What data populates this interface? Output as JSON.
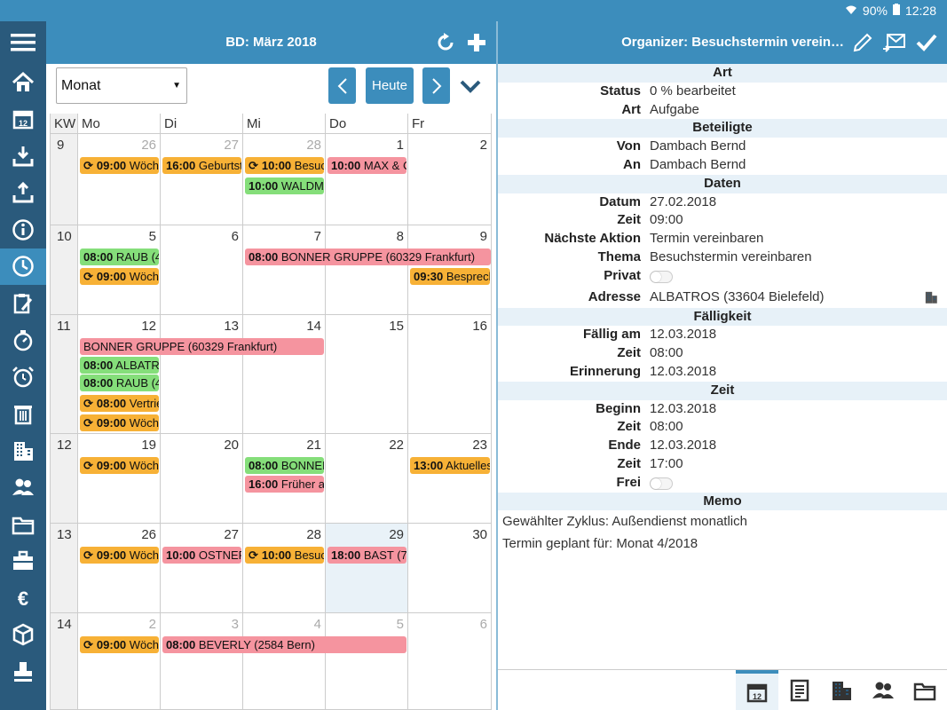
{
  "status_bar": {
    "battery": "90%",
    "time": "12:28"
  },
  "sidebar": {
    "items": [
      {
        "icon": "home-icon"
      },
      {
        "icon": "calendar-icon"
      },
      {
        "icon": "inbox-download-icon"
      },
      {
        "icon": "outbox-upload-icon"
      },
      {
        "icon": "info-icon"
      },
      {
        "icon": "clock-icon",
        "active": true
      },
      {
        "icon": "clipboard-edit-icon"
      },
      {
        "icon": "stopwatch-icon"
      },
      {
        "icon": "alarm-icon"
      },
      {
        "icon": "trash-icon"
      },
      {
        "icon": "building-icon"
      },
      {
        "icon": "contacts-icon"
      },
      {
        "icon": "folder-icon"
      },
      {
        "icon": "briefcase-icon"
      },
      {
        "icon": "euro-icon"
      },
      {
        "icon": "package-icon"
      },
      {
        "icon": "stamp-icon"
      }
    ]
  },
  "calendar": {
    "title": "BD: März 2018",
    "view_select": "Monat",
    "today_label": "Heute",
    "col_headers": [
      "KW",
      "Mo",
      "Di",
      "Mi",
      "Do",
      "Fr"
    ],
    "weeks": [
      {
        "kw": "9",
        "days": [
          {
            "n": "26",
            "other": true
          },
          {
            "n": "27",
            "other": true
          },
          {
            "n": "28",
            "other": true
          },
          {
            "n": "1"
          },
          {
            "n": "2"
          }
        ]
      },
      {
        "kw": "10",
        "days": [
          {
            "n": "5"
          },
          {
            "n": "6"
          },
          {
            "n": "7"
          },
          {
            "n": "8"
          },
          {
            "n": "9"
          }
        ]
      },
      {
        "kw": "11",
        "days": [
          {
            "n": "12"
          },
          {
            "n": "13"
          },
          {
            "n": "14"
          },
          {
            "n": "15"
          },
          {
            "n": "16"
          }
        ]
      },
      {
        "kw": "12",
        "days": [
          {
            "n": "19"
          },
          {
            "n": "20"
          },
          {
            "n": "21"
          },
          {
            "n": "22"
          },
          {
            "n": "23"
          }
        ]
      },
      {
        "kw": "13",
        "days": [
          {
            "n": "26"
          },
          {
            "n": "27"
          },
          {
            "n": "28"
          },
          {
            "n": "29",
            "today": true
          },
          {
            "n": "30"
          }
        ]
      },
      {
        "kw": "14",
        "days": [
          {
            "n": "2",
            "other": true
          },
          {
            "n": "3",
            "other": true
          },
          {
            "n": "4",
            "other": true
          },
          {
            "n": "5",
            "other": true
          },
          {
            "n": "6",
            "other": true
          }
        ]
      }
    ],
    "events": [
      {
        "w": 0,
        "d": 0,
        "span": 1,
        "slot": 0,
        "color": "o",
        "cyc": true,
        "time": "09:00",
        "text": "Wöchentlich"
      },
      {
        "w": 0,
        "d": 1,
        "span": 1,
        "slot": 0,
        "color": "o",
        "cyc": false,
        "time": "16:00",
        "text": "Geburtstag"
      },
      {
        "w": 0,
        "d": 2,
        "span": 1,
        "slot": 0,
        "color": "o",
        "cyc": true,
        "time": "10:00",
        "text": "Besuch"
      },
      {
        "w": 0,
        "d": 2,
        "span": 1,
        "slot": 1,
        "color": "g",
        "cyc": false,
        "time": "10:00",
        "text": "WALDMANN"
      },
      {
        "w": 0,
        "d": 3,
        "span": 1,
        "slot": 0,
        "color": "p",
        "cyc": false,
        "time": "10:00",
        "text": "MAX & CO"
      },
      {
        "w": 1,
        "d": 0,
        "span": 1,
        "slot": 0,
        "color": "g",
        "cyc": false,
        "time": "08:00",
        "text": "RAUB (4"
      },
      {
        "w": 1,
        "d": 0,
        "span": 1,
        "slot": 1,
        "color": "o",
        "cyc": true,
        "time": "09:00",
        "text": "Wöchentlich"
      },
      {
        "w": 1,
        "d": 2,
        "span": 3,
        "slot": 0,
        "color": "p",
        "cyc": false,
        "time": "08:00",
        "text": "BONNER GRUPPE (60329 Frankfurt)"
      },
      {
        "w": 1,
        "d": 4,
        "span": 1,
        "slot": 1,
        "color": "o",
        "cyc": false,
        "time": "09:30",
        "text": "Besprechung"
      },
      {
        "w": 2,
        "d": 0,
        "span": 3,
        "slot": 0,
        "color": "p",
        "cyc": false,
        "time": "",
        "text": "BONNER GRUPPE (60329 Frankfurt)"
      },
      {
        "w": 2,
        "d": 0,
        "span": 1,
        "slot": 1,
        "color": "g",
        "cyc": false,
        "time": "08:00",
        "text": "ALBATROS"
      },
      {
        "w": 2,
        "d": 0,
        "span": 1,
        "slot": 2,
        "color": "g",
        "cyc": false,
        "time": "08:00",
        "text": "RAUB (4"
      },
      {
        "w": 2,
        "d": 0,
        "span": 1,
        "slot": 3,
        "color": "o",
        "cyc": true,
        "time": "08:00",
        "text": "Vertrieb"
      },
      {
        "w": 2,
        "d": 0,
        "span": 1,
        "slot": 4,
        "color": "o",
        "cyc": true,
        "time": "09:00",
        "text": "Wöchentlich"
      },
      {
        "w": 3,
        "d": 0,
        "span": 1,
        "slot": 0,
        "color": "o",
        "cyc": true,
        "time": "09:00",
        "text": "Wöchentlich"
      },
      {
        "w": 3,
        "d": 2,
        "span": 1,
        "slot": 0,
        "color": "g",
        "cyc": false,
        "time": "08:00",
        "text": "BONNER"
      },
      {
        "w": 3,
        "d": 2,
        "span": 1,
        "slot": 1,
        "color": "p",
        "cyc": false,
        "time": "16:00",
        "text": "Früher als"
      },
      {
        "w": 3,
        "d": 4,
        "span": 1,
        "slot": 0,
        "color": "o",
        "cyc": false,
        "time": "13:00",
        "text": "Aktuelles"
      },
      {
        "w": 4,
        "d": 0,
        "span": 1,
        "slot": 0,
        "color": "o",
        "cyc": true,
        "time": "09:00",
        "text": "Wöchentlich"
      },
      {
        "w": 4,
        "d": 1,
        "span": 1,
        "slot": 0,
        "color": "p",
        "cyc": false,
        "time": "10:00",
        "text": "OSTNER"
      },
      {
        "w": 4,
        "d": 2,
        "span": 1,
        "slot": 0,
        "color": "o",
        "cyc": true,
        "time": "10:00",
        "text": "Besuch"
      },
      {
        "w": 4,
        "d": 3,
        "span": 1,
        "slot": 0,
        "color": "p",
        "cyc": false,
        "time": "18:00",
        "text": "BAST (7"
      },
      {
        "w": 5,
        "d": 0,
        "span": 1,
        "slot": 0,
        "color": "o",
        "cyc": true,
        "time": "09:00",
        "text": "Wöchentlich"
      },
      {
        "w": 5,
        "d": 1,
        "span": 3,
        "slot": 0,
        "color": "p",
        "cyc": false,
        "time": "08:00",
        "text": "BEVERLY (2584 Bern)"
      }
    ]
  },
  "detail": {
    "title": "Organizer: Besuchstermin verein…",
    "sections": [
      {
        "title": "Art",
        "rows": [
          {
            "label": "Status",
            "value": "0 % bearbeitet"
          },
          {
            "label": "Art",
            "value": "Aufgabe"
          }
        ]
      },
      {
        "title": "Beteiligte",
        "rows": [
          {
            "label": "Von",
            "value": "Dambach Bernd"
          },
          {
            "label": "An",
            "value": "Dambach Bernd"
          }
        ]
      },
      {
        "title": "Daten",
        "rows": [
          {
            "label": "Datum",
            "value": "27.02.2018"
          },
          {
            "label": "Zeit",
            "value": "09:00"
          },
          {
            "label": "Nächste Aktion",
            "value": "Termin vereinbaren"
          },
          {
            "label": "Thema",
            "value": "Besuchstermin vereinbaren"
          },
          {
            "label": "Privat",
            "toggle": true
          },
          {
            "label": "Adresse",
            "value": "ALBATROS (33604 Bielefeld)",
            "tall": true,
            "icon": "building-icon"
          }
        ]
      },
      {
        "title": "Fälligkeit",
        "rows": [
          {
            "label": "Fällig am",
            "value": "12.03.2018"
          },
          {
            "label": "Zeit",
            "value": "08:00"
          },
          {
            "label": "Erinnerung",
            "value": "12.03.2018"
          }
        ]
      },
      {
        "title": "Zeit",
        "rows": [
          {
            "label": "Beginn",
            "value": "12.03.2018"
          },
          {
            "label": "Zeit",
            "value": "08:00"
          },
          {
            "label": "Ende",
            "value": "12.03.2018"
          },
          {
            "label": "Zeit",
            "value": "17:00"
          },
          {
            "label": "Frei",
            "toggle": true
          }
        ]
      },
      {
        "title": "Memo",
        "rows": []
      }
    ],
    "memo": [
      "Gewählter Zyklus: Außendienst monatlich",
      "Termin geplant für: Monat 4/2018"
    ]
  },
  "tabbar": [
    "calendar-icon",
    "document-icon",
    "building-icon",
    "contacts-icon",
    "folder-icon"
  ]
}
